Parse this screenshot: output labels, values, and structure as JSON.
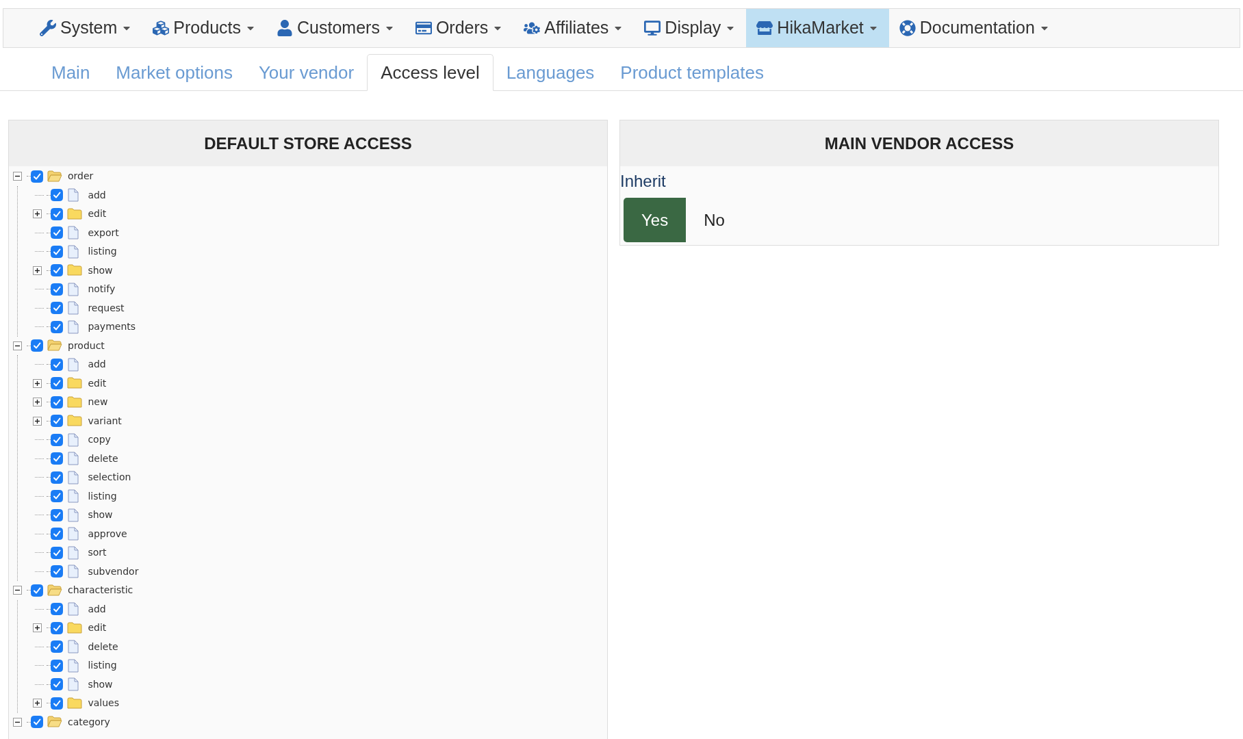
{
  "menu": [
    {
      "label": "System",
      "selected": false
    },
    {
      "label": "Products",
      "selected": false
    },
    {
      "label": "Customers",
      "selected": false
    },
    {
      "label": "Orders",
      "selected": false
    },
    {
      "label": "Affiliates",
      "selected": false
    },
    {
      "label": "Display",
      "selected": false
    },
    {
      "label": "HikaMarket",
      "selected": true
    },
    {
      "label": "Documentation",
      "selected": false
    }
  ],
  "tabs": [
    {
      "label": "Main",
      "selected": false
    },
    {
      "label": "Market options",
      "selected": false
    },
    {
      "label": "Your vendor",
      "selected": false
    },
    {
      "label": "Access level",
      "selected": true
    },
    {
      "label": "Languages",
      "selected": false
    },
    {
      "label": "Product templates",
      "selected": false
    }
  ],
  "default_store_access": {
    "title": "DEFAULT STORE ACCESS",
    "tree": [
      {
        "label": "order",
        "kind": "folder",
        "checked": true,
        "expanded": true,
        "children": [
          {
            "label": "add",
            "kind": "file",
            "checked": true
          },
          {
            "label": "edit",
            "kind": "folder",
            "checked": true,
            "expanded": false
          },
          {
            "label": "export",
            "kind": "file",
            "checked": true
          },
          {
            "label": "listing",
            "kind": "file",
            "checked": true
          },
          {
            "label": "show",
            "kind": "folder",
            "checked": true,
            "expanded": false
          },
          {
            "label": "notify",
            "kind": "file",
            "checked": true
          },
          {
            "label": "request",
            "kind": "file",
            "checked": true
          },
          {
            "label": "payments",
            "kind": "file",
            "checked": true
          }
        ]
      },
      {
        "label": "product",
        "kind": "folder",
        "checked": true,
        "expanded": true,
        "children": [
          {
            "label": "add",
            "kind": "file",
            "checked": true
          },
          {
            "label": "edit",
            "kind": "folder",
            "checked": true,
            "expanded": false
          },
          {
            "label": "new",
            "kind": "folder",
            "checked": true,
            "expanded": false
          },
          {
            "label": "variant",
            "kind": "folder",
            "checked": true,
            "expanded": false
          },
          {
            "label": "copy",
            "kind": "file",
            "checked": true
          },
          {
            "label": "delete",
            "kind": "file",
            "checked": true
          },
          {
            "label": "selection",
            "kind": "file",
            "checked": true
          },
          {
            "label": "listing",
            "kind": "file",
            "checked": true
          },
          {
            "label": "show",
            "kind": "file",
            "checked": true
          },
          {
            "label": "approve",
            "kind": "file",
            "checked": true
          },
          {
            "label": "sort",
            "kind": "file",
            "checked": true
          },
          {
            "label": "subvendor",
            "kind": "file",
            "checked": true
          }
        ]
      },
      {
        "label": "characteristic",
        "kind": "folder",
        "checked": true,
        "expanded": true,
        "children": [
          {
            "label": "add",
            "kind": "file",
            "checked": true
          },
          {
            "label": "edit",
            "kind": "folder",
            "checked": true,
            "expanded": false
          },
          {
            "label": "delete",
            "kind": "file",
            "checked": true
          },
          {
            "label": "listing",
            "kind": "file",
            "checked": true
          },
          {
            "label": "show",
            "kind": "file",
            "checked": true
          },
          {
            "label": "values",
            "kind": "folder",
            "checked": true,
            "expanded": false
          }
        ]
      },
      {
        "label": "category",
        "kind": "folder",
        "checked": true,
        "expanded": true
      }
    ]
  },
  "main_vendor_access": {
    "title": "MAIN VENDOR ACCESS",
    "field_label": "Inherit",
    "options": [
      {
        "label": "Yes",
        "selected": true
      },
      {
        "label": "No",
        "selected": false
      }
    ]
  }
}
